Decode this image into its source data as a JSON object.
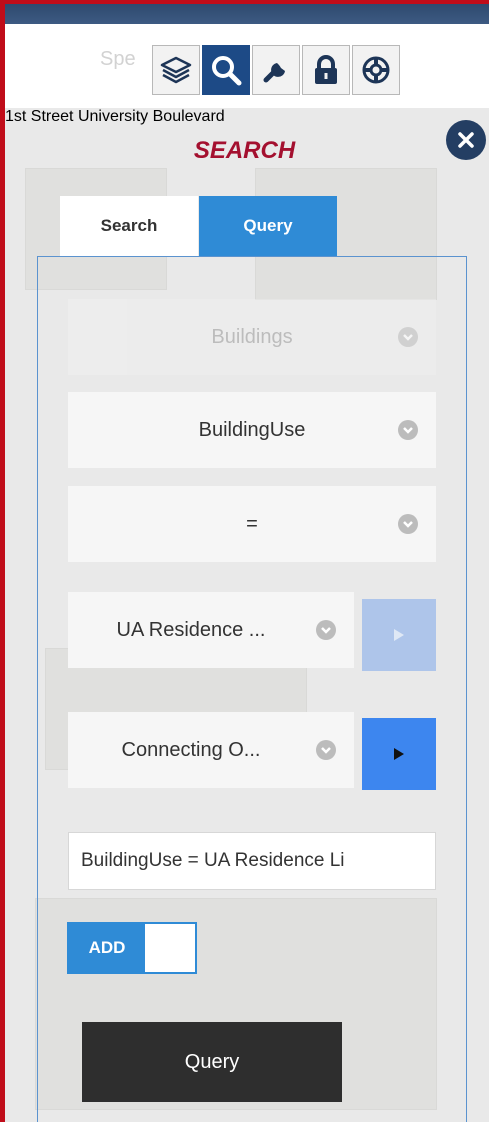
{
  "map": {
    "street_labels": [
      "Spe",
      "1st Street",
      "University Boulevard"
    ]
  },
  "toolbar": {
    "items": [
      {
        "name": "layers",
        "icon": "layers-icon",
        "active": false
      },
      {
        "name": "search",
        "icon": "search-icon",
        "active": true
      },
      {
        "name": "tools",
        "icon": "wrench-icon",
        "active": false
      },
      {
        "name": "lock",
        "icon": "lock-icon",
        "active": false
      },
      {
        "name": "help",
        "icon": "lifebuoy-icon",
        "active": false
      }
    ]
  },
  "panel": {
    "title": "SEARCH",
    "close_icon": "close-icon",
    "tabs": [
      {
        "label": "Search",
        "active": false
      },
      {
        "label": "Query",
        "active": true
      }
    ]
  },
  "query": {
    "layer": "Buildings",
    "field": "BuildingUse",
    "operator": "=",
    "value": "UA Residence ...",
    "connector": "Connecting O...",
    "expression": "BuildingUse = UA Residence Li",
    "add_label": "ADD",
    "submit_label": "Query"
  },
  "colors": {
    "accent_blue": "#2f8bd6",
    "title_red": "#a4102f",
    "toolbar_active": "#1d4a86",
    "play_enabled": "#3d86ef"
  }
}
